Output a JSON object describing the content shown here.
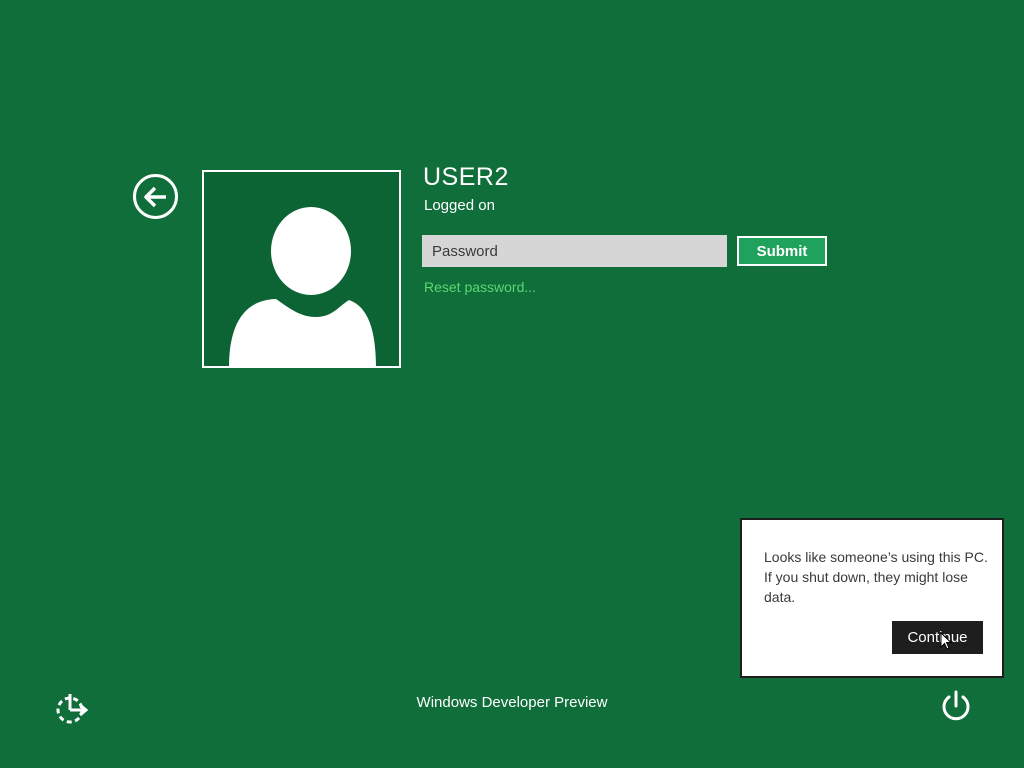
{
  "user": {
    "name": "USER2",
    "status": "Logged on"
  },
  "login": {
    "password_placeholder": "Password",
    "submit_label": "Submit",
    "reset_link": "Reset password..."
  },
  "dialog": {
    "message": "Looks like someone’s using this PC. If you shut down, they might lose data.",
    "continue_label": "Continue"
  },
  "footer": {
    "brand": "Windows Developer Preview"
  },
  "icons": {
    "back": "back-arrow-icon",
    "avatar": "user-silhouette-icon",
    "ease_of_access": "ease-of-access-icon",
    "power": "power-icon",
    "cursor": "mouse-pointer-icon"
  },
  "colors": {
    "background": "#0f6e3a",
    "avatar_bg": "#0c6334",
    "submit_bg": "#1fa35c",
    "link": "#5ad873",
    "dialog_button": "#1e1e1e"
  }
}
